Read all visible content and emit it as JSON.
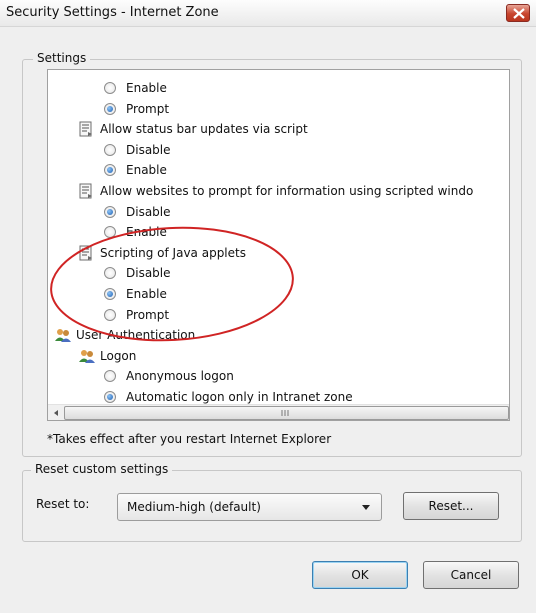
{
  "window": {
    "title": "Security Settings - Internet Zone"
  },
  "settings_group": {
    "label": "Settings"
  },
  "list_rows": [
    {
      "kind": "radio",
      "label": "Enable",
      "checked": false,
      "indent": 2
    },
    {
      "kind": "radio",
      "label": "Prompt",
      "checked": true,
      "indent": 2
    },
    {
      "kind": "setting",
      "label": "Allow status bar updates via script",
      "icon": "script-setting-icon",
      "indent": 1
    },
    {
      "kind": "radio",
      "label": "Disable",
      "checked": false,
      "indent": 2
    },
    {
      "kind": "radio",
      "label": "Enable",
      "checked": true,
      "indent": 2
    },
    {
      "kind": "setting",
      "label": "Allow websites to prompt for information using scripted windo",
      "icon": "script-setting-icon",
      "indent": 1
    },
    {
      "kind": "radio",
      "label": "Disable",
      "checked": true,
      "indent": 2
    },
    {
      "kind": "radio",
      "label": "Enable",
      "checked": false,
      "indent": 2
    },
    {
      "kind": "setting",
      "label": "Scripting of Java applets",
      "icon": "script-setting-icon",
      "indent": 1
    },
    {
      "kind": "radio",
      "label": "Disable",
      "checked": false,
      "indent": 2
    },
    {
      "kind": "radio",
      "label": "Enable",
      "checked": true,
      "indent": 2
    },
    {
      "kind": "radio",
      "label": "Prompt",
      "checked": false,
      "indent": 2
    },
    {
      "kind": "category",
      "label": "User Authentication",
      "icon": "users-icon",
      "indent": 0
    },
    {
      "kind": "category",
      "label": "Logon",
      "icon": "users-icon",
      "indent": 1
    },
    {
      "kind": "radio",
      "label": "Anonymous logon",
      "checked": false,
      "indent": 2
    },
    {
      "kind": "radio",
      "label": "Automatic logon only in Intranet zone",
      "checked": true,
      "indent": 2
    }
  ],
  "footnote": "*Takes effect after you restart Internet Explorer",
  "reset_group": {
    "label": "Reset custom settings",
    "reset_to_label": "Reset to:",
    "selected": "Medium-high (default)",
    "reset_button": "Reset..."
  },
  "buttons": {
    "ok": "OK",
    "cancel": "Cancel"
  },
  "colors": {
    "annotation": "#d02424",
    "close_button": "#c8452e",
    "radio_checked": "#1d5fb2"
  }
}
